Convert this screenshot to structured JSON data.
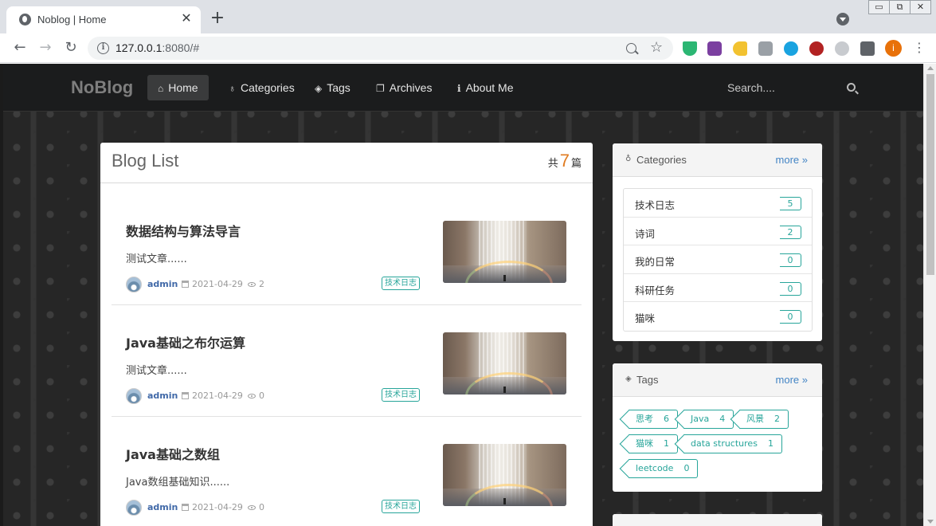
{
  "browser": {
    "tab_title": "Noblog | Home",
    "url_host": "127.0.0.1",
    "url_rest": ":8080/#",
    "window_controls": [
      "minimize",
      "restore",
      "close"
    ]
  },
  "site": {
    "logo": "NoBlog",
    "nav": [
      {
        "label": "Home",
        "icon": "home-icon",
        "active": true
      },
      {
        "label": "Categories",
        "icon": "lightbulb-icon",
        "active": false
      },
      {
        "label": "Tags",
        "icon": "tags-icon",
        "active": false
      },
      {
        "label": "Archives",
        "icon": "clone-icon",
        "active": false
      },
      {
        "label": "About Me",
        "icon": "info-icon",
        "active": false
      }
    ],
    "search_placeholder": "Search...."
  },
  "blog": {
    "title": "Blog List",
    "count_prefix": "共",
    "count": "7",
    "count_suffix": "篇",
    "posts": [
      {
        "title": "数据结构与算法导言",
        "desc": "测试文章......",
        "author": "admin",
        "date": "2021-04-29",
        "views": "2",
        "tag": "技术日志"
      },
      {
        "title": "Java基础之布尔运算",
        "desc": "测试文章......",
        "author": "admin",
        "date": "2021-04-29",
        "views": "0",
        "tag": "技术日志"
      },
      {
        "title": "Java基础之数组",
        "desc": "Java数组基础知识......",
        "author": "admin",
        "date": "2021-04-29",
        "views": "0",
        "tag": "技术日志"
      }
    ]
  },
  "sidebar": {
    "categories": {
      "title": "Categories",
      "more": "more",
      "items": [
        {
          "name": "技术日志",
          "count": "5"
        },
        {
          "name": "诗词",
          "count": "2"
        },
        {
          "name": "我的日常",
          "count": "0"
        },
        {
          "name": "科研任务",
          "count": "0"
        },
        {
          "name": "猫咪",
          "count": "0"
        }
      ]
    },
    "tags": {
      "title": "Tags",
      "more": "more",
      "items": [
        {
          "name": "思考",
          "count": "6"
        },
        {
          "name": "Java",
          "count": "4"
        },
        {
          "name": "风景",
          "count": "2"
        },
        {
          "name": "猫咪",
          "count": "1"
        },
        {
          "name": "data structures",
          "count": "1"
        },
        {
          "name": "leetcode",
          "count": "0"
        }
      ]
    }
  },
  "colors": {
    "accent_teal": "#27a59a",
    "link_blue": "#4183c4",
    "count_orange": "#e07b20",
    "nav_bg": "#1b1c1d"
  }
}
